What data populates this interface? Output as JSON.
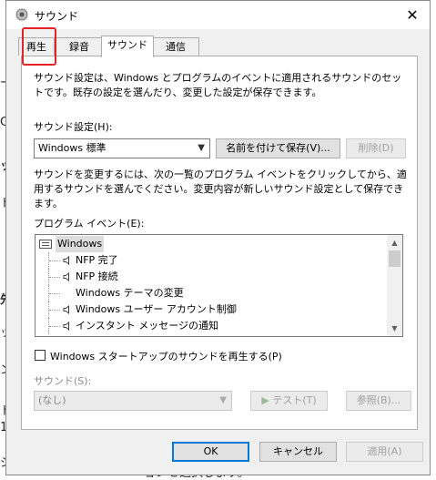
{
  "background": {
    "fragments": [
      "ー",
      "C",
      "ッ",
      "ト",
      "先",
      "ッ",
      "ン",
      "ト",
      "1",
      "ジ",
      "J",
      "ョンを選択します。"
    ]
  },
  "window": {
    "title": "サウンド",
    "close_glyph": "✕"
  },
  "tabs": [
    {
      "label": "再生"
    },
    {
      "label": "録音"
    },
    {
      "label": "サウンド"
    },
    {
      "label": "通信"
    }
  ],
  "sounds_tab": {
    "intro": "サウンド設定は、Windows とプログラムのイベントに適用されるサウンドのセットです。既存の設定を選んだり、変更した設定が保存できます。",
    "scheme_label": "サウンド設定(H):",
    "scheme_value": "Windows 標準",
    "save_as_label": "名前を付けて保存(V)...",
    "delete_label": "削除(D)",
    "instructions": "サウンドを変更するには、次の一覧のプログラム イベントをクリックしてから、適用するサウンドを選んでください。変更内容が新しいサウンド設定として保存できます。",
    "events_label": "プログラム イベント(E):",
    "events": [
      {
        "label": "Windows",
        "root": true,
        "speaker": false
      },
      {
        "label": "NFP 完了",
        "speaker": true
      },
      {
        "label": "NFP 接続",
        "speaker": true
      },
      {
        "label": "Windows テーマの変更",
        "speaker": false
      },
      {
        "label": "Windows ユーザー アカウント制御",
        "speaker": true
      },
      {
        "label": "インスタント メッセージの通知",
        "speaker": true
      }
    ],
    "startup_checkbox_label": "Windows スタートアップのサウンドを再生する(P)",
    "sound_label": "サウンド(S):",
    "sound_value": "(なし)",
    "test_label": "テスト(T)",
    "browse_label": "参照(B)..."
  },
  "footer": {
    "ok_label": "OK",
    "cancel_label": "キャンセル",
    "apply_label": "適用(A)"
  }
}
